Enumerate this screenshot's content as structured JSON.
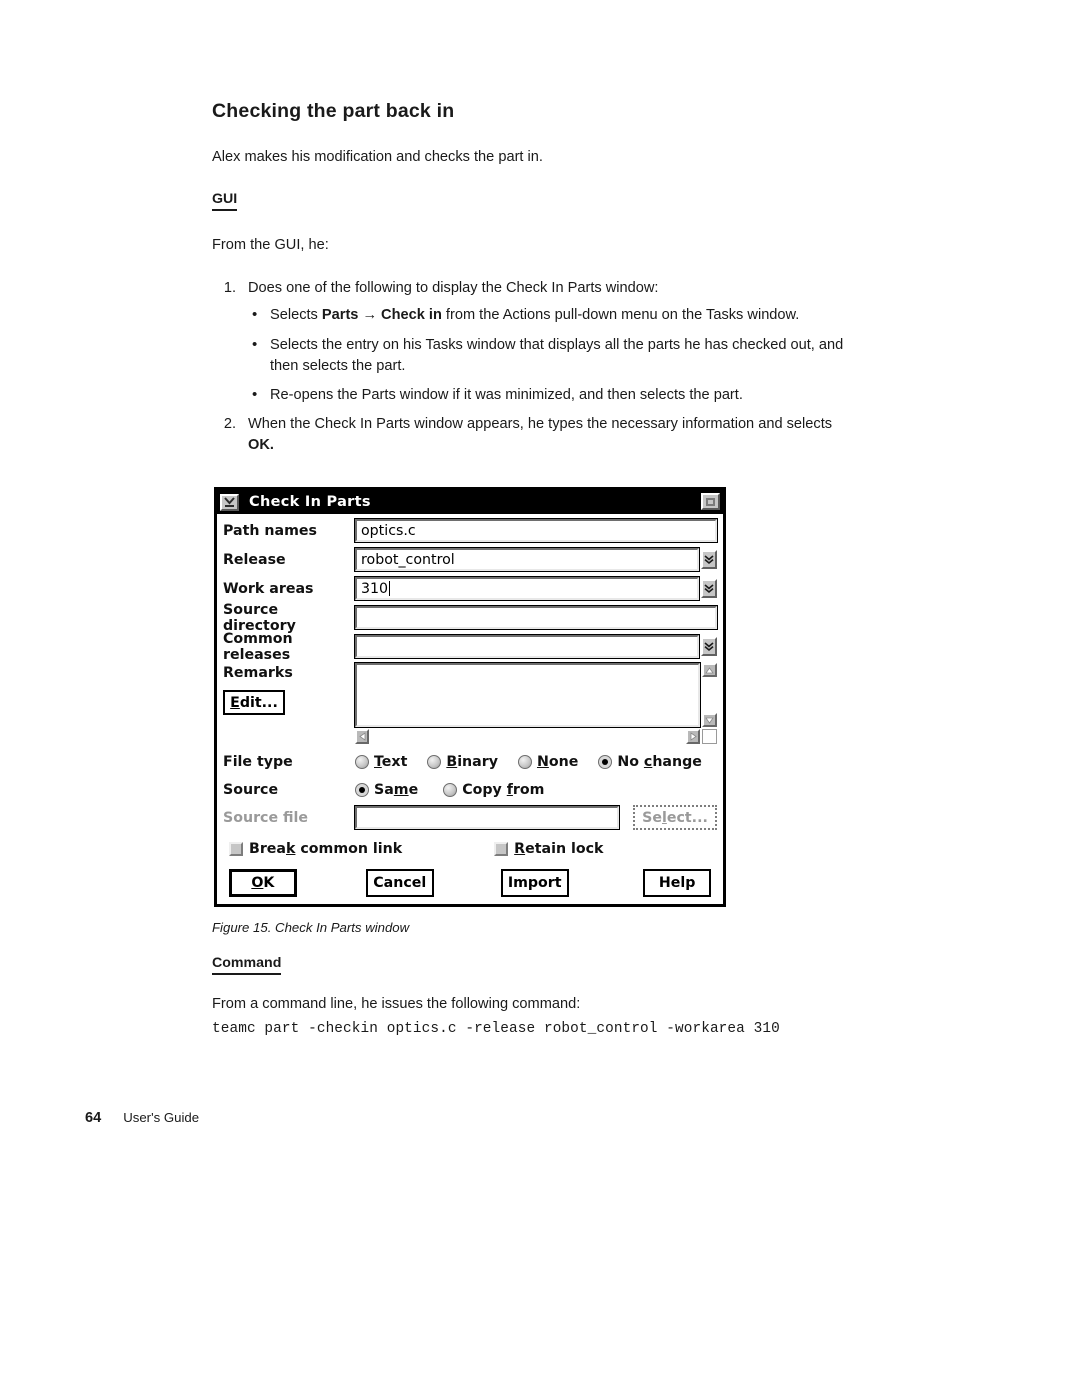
{
  "document": {
    "title": "Checking the part back in",
    "intro": "Alex makes his modification and checks the part in.",
    "gui_heading": "GUI",
    "gui_intro": "From the GUI, he:",
    "step1": {
      "num": "1.",
      "text": "Does one of the following to display the Check In Parts window:",
      "bullets": [
        {
          "pre": "Selects ",
          "bold1": "Parts",
          "arrow": "→",
          "bold2": "Check in",
          "post": " from the Actions pull-down menu on the Tasks window."
        },
        {
          "text": "Selects the entry on his Tasks window that displays all the parts he has checked out, and then selects the part."
        },
        {
          "text": "Re-opens the Parts window if it was minimized, and then selects the part."
        }
      ]
    },
    "step2": {
      "num": "2.",
      "pre": "When the Check In Parts window appears, he types the necessary information and selects ",
      "bold": "OK."
    },
    "figure_caption": "Figure 15. Check In Parts window",
    "command_heading": "Command",
    "command_intro": "From a command line, he issues the following command:",
    "command_line": "teamc part -checkin optics.c -release robot_control -workarea 310"
  },
  "footer": {
    "page_number": "64",
    "book_title": "User's Guide"
  },
  "dialog": {
    "title": "Check In Parts",
    "window_menu_icon": "window-menu-icon",
    "maximize_icon": "maximize-icon",
    "fields": {
      "path_names": {
        "label": "Path names",
        "value": "optics.c",
        "has_dropdown": false
      },
      "release": {
        "label": "Release",
        "value": "robot_control",
        "has_dropdown": true
      },
      "work_areas": {
        "label": "Work areas",
        "value": "310",
        "has_dropdown": true,
        "caret": true
      },
      "source_directory": {
        "label": "Source directory",
        "value": "",
        "has_dropdown": false
      },
      "common_releases": {
        "label": "Common releases",
        "value": "",
        "has_dropdown": true
      }
    },
    "remarks": {
      "label": "Remarks",
      "edit_button": "Edit...",
      "value": "",
      "scroll_up_icon": "scroll-up-icon",
      "scroll_down_icon": "scroll-down-icon",
      "scroll_left_icon": "scroll-left-icon",
      "scroll_right_icon": "scroll-right-icon"
    },
    "file_type": {
      "label": "File type",
      "options": [
        {
          "label": "Text",
          "mnemonic": "T",
          "selected": false
        },
        {
          "label": "Binary",
          "mnemonic": "B",
          "selected": false
        },
        {
          "label": "None",
          "mnemonic": "N",
          "selected": false
        },
        {
          "label": "No change",
          "mnemonic": "c",
          "selected": true
        }
      ]
    },
    "source": {
      "label": "Source",
      "options": [
        {
          "label": "Same",
          "mnemonic": "m",
          "selected": true
        },
        {
          "label": "Copy from",
          "mnemonic": "f",
          "selected": false
        }
      ]
    },
    "source_file": {
      "label": "Source file",
      "value": "",
      "disabled": true,
      "select_button": "Select...",
      "select_disabled": true
    },
    "checkboxes": [
      {
        "label": "Break common link",
        "mnemonic": "k",
        "checked": false
      },
      {
        "label": "Retain lock",
        "mnemonic": "R",
        "checked": false
      }
    ],
    "buttons": [
      {
        "label": "OK",
        "mnemonic": "O",
        "default": true
      },
      {
        "label": "Cancel",
        "mnemonic": "",
        "default": false
      },
      {
        "label": "Import",
        "mnemonic": "",
        "default": false
      },
      {
        "label": "Help",
        "mnemonic": "",
        "default": false
      }
    ]
  }
}
